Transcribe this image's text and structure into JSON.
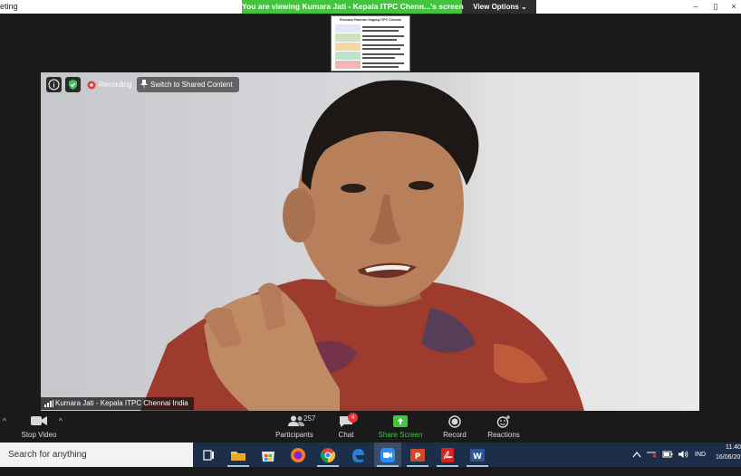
{
  "window": {
    "app_title": "eting",
    "minimize_glyph": "–",
    "restore_glyph": "▯",
    "close_glyph": "×"
  },
  "share_banner": {
    "text": "You are viewing Kumara Jati - Kepala ITPC Chenn...'s screen",
    "view_options_label": "View Options ⌄"
  },
  "shared_thumbnail": {
    "title": "Rencana Pameran Dagang ITPC Chennai"
  },
  "top_controls": {
    "recording_label": "Recording",
    "switch_label": "Switch to Shared Content",
    "info_icon": "info-icon",
    "security_icon": "shield-check-icon"
  },
  "video": {
    "participant_name": "Kumara Jati - Kepala ITPC Chennai India"
  },
  "toolbar": {
    "stop_video_label": "Stop Video",
    "participants_label": "Participants",
    "participants_count": "257",
    "chat_label": "Chat",
    "chat_badge": "4",
    "share_screen_label": "Share Screen",
    "record_label": "Record",
    "reactions_label": "Reactions",
    "share_color": "#43c43d"
  },
  "taskbar": {
    "search_placeholder": "Search for anything",
    "language": "IND",
    "time": "11.40",
    "date": "16/06/20",
    "apps": [
      "task-view-icon",
      "file-explorer-icon",
      "store-icon",
      "firefox-icon",
      "chrome-icon",
      "edge-icon",
      "zoom-icon",
      "powerpoint-icon",
      "acrobat-icon",
      "word-icon"
    ]
  }
}
